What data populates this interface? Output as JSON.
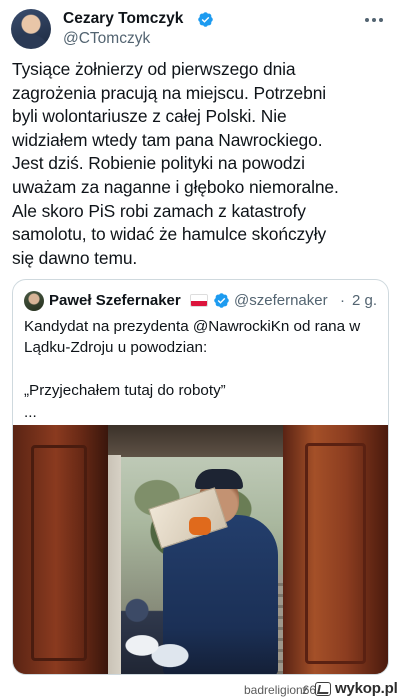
{
  "author": {
    "name": "Cezary Tomczyk",
    "handle": "@CTomczyk",
    "verified_icon": "verified-badge-icon"
  },
  "tweet": {
    "text": "Tysiące żołnierzy od pierwszego dnia\nzagrożenia pracują na miejscu. Potrzebni\nbyli wolontariusze z całej Polski. Nie\nwidziałem wtedy tam pana Nawrockiego.\nJest dziś. Robienie polityki na powodzi\nuważam za naganne i głęboko niemoralne.\nAle skoro PiS robi zamach z katastrofy\nsamolotu, to widać że hamulce skończyły\nsię dawno temu."
  },
  "quoted_tweet": {
    "name": "Paweł Szefernaker",
    "flag": "polish-flag-icon",
    "handle": "@szefernaker",
    "separator": "·",
    "time": "2 g.",
    "text": "Kandydat na prezydenta @NawrockiKn od rana w\nLądku-Zdroju u powodzian:\n\n„Przyjechałem tutaj do roboty”\n..."
  },
  "watermark": {
    "username": "badreligion66",
    "z": "z",
    "site": "wykop.pl"
  },
  "colors": {
    "text": "#0f1419",
    "secondary": "#536471",
    "verified": "#1d9bf0",
    "border": "#cfd9de"
  }
}
